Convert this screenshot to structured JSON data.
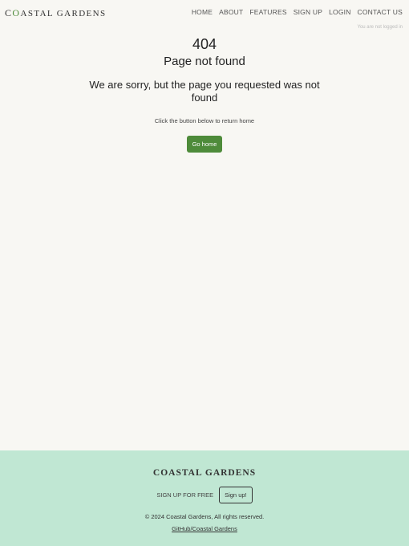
{
  "header": {
    "brand_first_letter": "C",
    "brand_o": "O",
    "brand_rest": "ASTAL GARDENS",
    "nav": [
      "HOME",
      "ABOUT",
      "FEATURES",
      "SIGN UP",
      "LOGIN",
      "CONTACT US"
    ],
    "login_status": "You are not logged in"
  },
  "main": {
    "code": "404",
    "title": "Page not found",
    "message": "We are sorry, but the page you requested was not found",
    "hint": "Click the button below to return home",
    "button": "Go home"
  },
  "footer": {
    "brand": "COASTAL GARDENS",
    "signup_text": "SIGN UP FOR FREE",
    "signup_button": "Sign up!",
    "copyright": "© 2024 Coastal Gardens, All rights reserved.",
    "link": "GitHub/Coastal Gardens"
  },
  "colors": {
    "accent": "#4e8b3a",
    "footer_bg": "#c0e7d3",
    "page_bg": "#f8f7f3"
  }
}
